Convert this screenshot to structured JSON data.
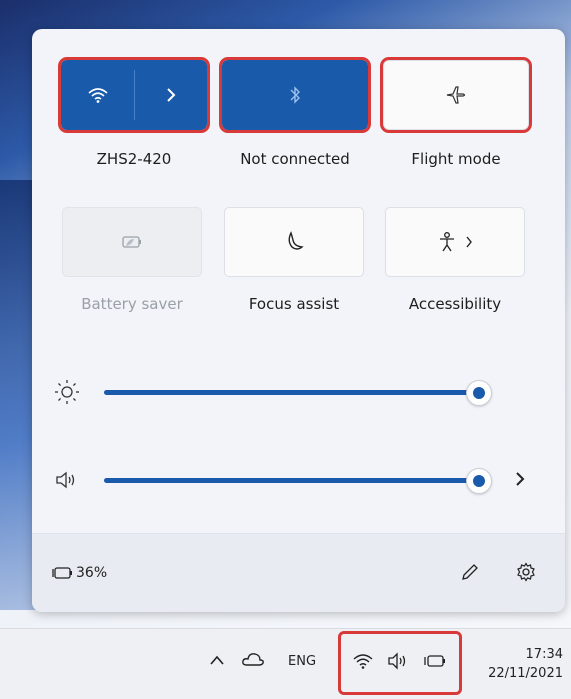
{
  "quick_settings": {
    "wifi": {
      "label": "ZHS2-420",
      "icon": "wifi-icon",
      "state": "on"
    },
    "bluetooth": {
      "label": "Not connected",
      "icon": "bluetooth-icon",
      "state": "on"
    },
    "flight_mode": {
      "label": "Flight mode",
      "icon": "airplane-icon",
      "state": "off"
    },
    "battery_saver": {
      "label": "Battery saver",
      "icon": "battery-saver-icon",
      "state": "disabled"
    },
    "focus_assist": {
      "label": "Focus assist",
      "icon": "moon-icon",
      "state": "off"
    },
    "accessibility": {
      "label": "Accessibility",
      "icon": "accessibility-icon",
      "state": "off"
    }
  },
  "sliders": {
    "brightness": {
      "icon": "brightness-icon",
      "value_percent": 100
    },
    "volume": {
      "icon": "speaker-icon",
      "value_percent": 100
    }
  },
  "footer": {
    "battery_text": "36%"
  },
  "taskbar": {
    "language": "ENG",
    "time": "17:34",
    "date": "22/11/2021"
  },
  "colors": {
    "accent": "#1a5aaa",
    "highlight": "#d83a3a"
  }
}
